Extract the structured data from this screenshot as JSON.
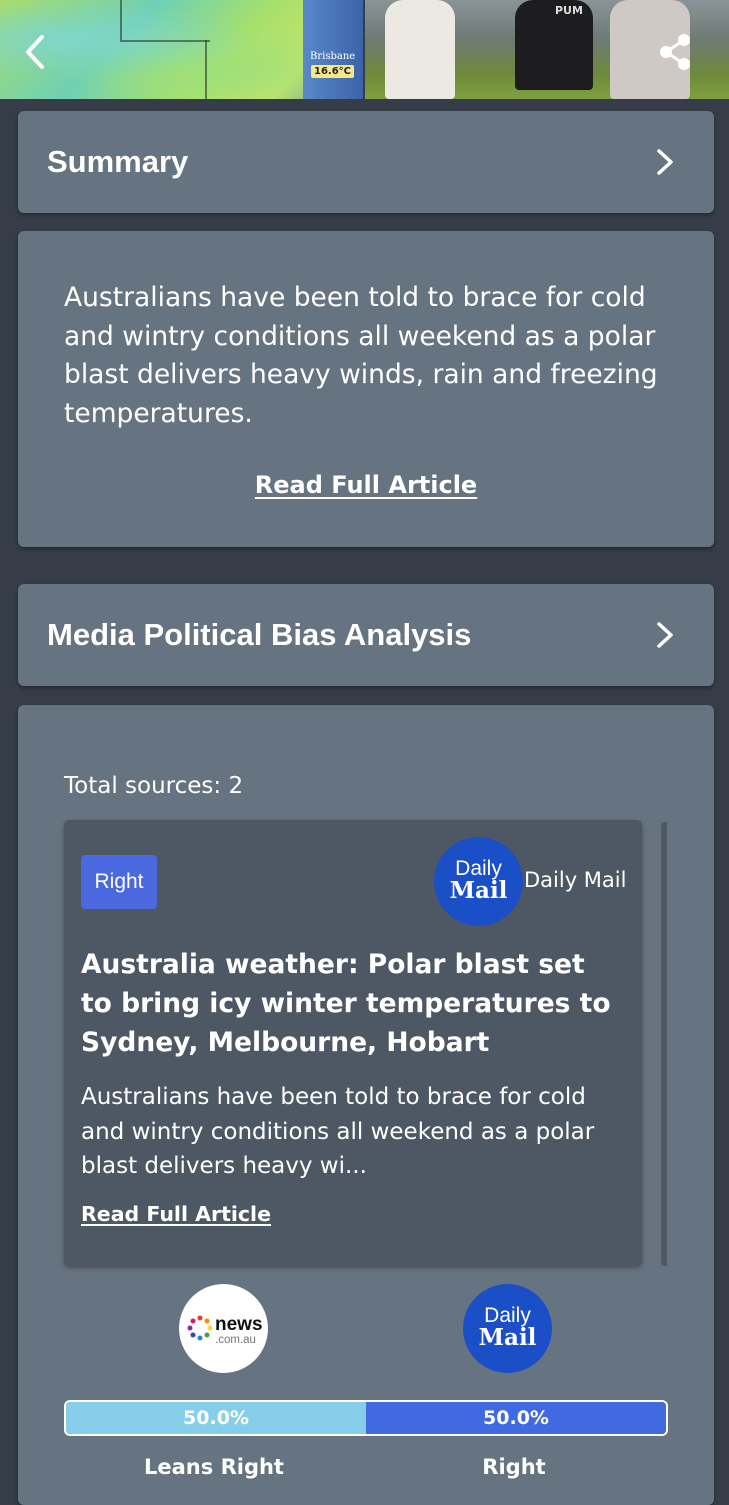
{
  "hero": {
    "map_city": "Brisbane",
    "map_temp": "16.6°C",
    "photo_text": "PUM"
  },
  "summary": {
    "header_title": "Summary",
    "text": "Australians have been told to brace for cold and wintry conditions all weekend as a polar blast delivers heavy winds, rain and freezing temperatures.",
    "read_link": "Read Full Article"
  },
  "bias_analysis": {
    "header_title": "Media Political Bias Analysis",
    "total_sources": "Total sources: 2",
    "article": {
      "bias_badge": "Right",
      "logo_line1": "Daily",
      "logo_line2": "Mail",
      "source_name": "Daily Mail",
      "title": "Australia weather: Polar blast set to bring icy winter temperatures to Sydney, Melbourne, Hobart",
      "excerpt": "Australians have been told to brace for cold and wintry conditions all weekend as a polar blast delivers heavy wi...",
      "read_link": "Read Full Article"
    },
    "outlets": [
      {
        "logo_line1": "news",
        "logo_line2": ".com.au"
      },
      {
        "logo_line1": "Daily",
        "logo_line2": "Mail"
      }
    ],
    "bias_bar": [
      {
        "label": "Leans Right",
        "percent_text": "50.0%",
        "share": 0.5,
        "color": "#87ceeb"
      },
      {
        "label": "Right",
        "percent_text": "50.0%",
        "share": 0.5,
        "color": "#4169e1"
      }
    ]
  }
}
